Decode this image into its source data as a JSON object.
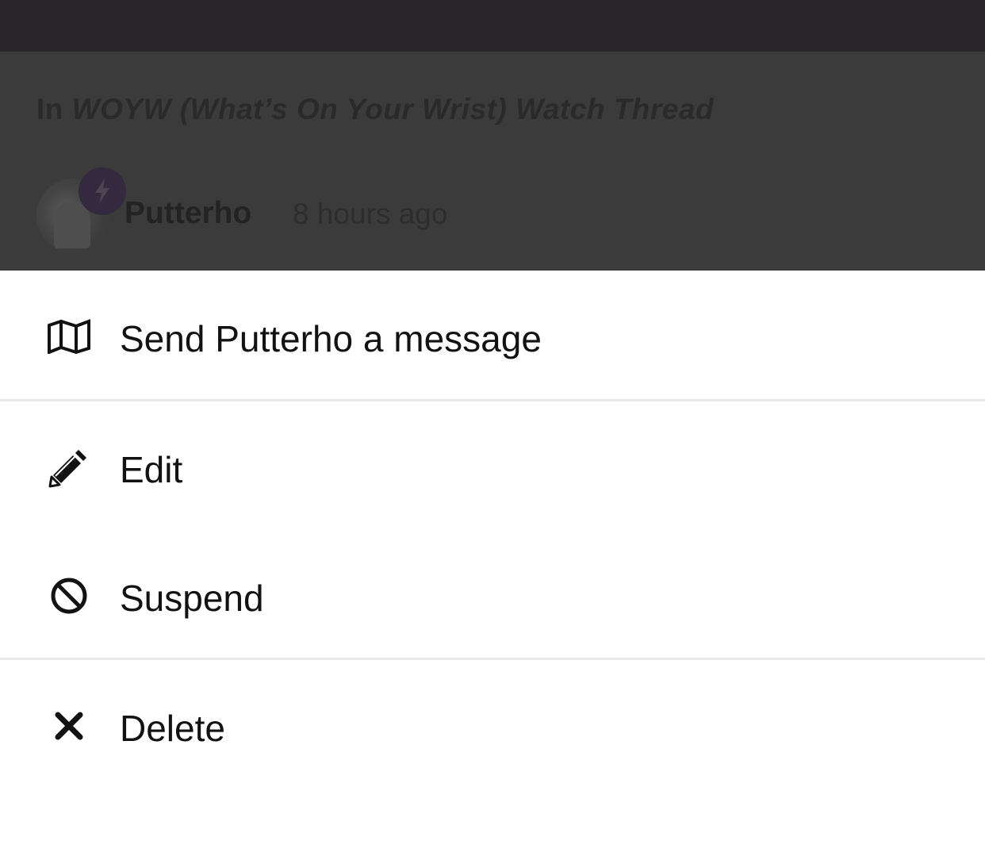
{
  "background_post": {
    "thread_prefix": "In",
    "thread_title": "WOYW (What’s On Your Wrist) Watch Thread",
    "author": "Putterho",
    "timestamp": "8 hours ago",
    "badge_icon": "lightning-icon",
    "avatar_icon": "user-avatar"
  },
  "action_sheet": {
    "items": [
      {
        "label": "Send Putterho a message",
        "icon": "map-icon"
      },
      {
        "label": "Edit",
        "icon": "pencil-icon"
      },
      {
        "label": "Suspend",
        "icon": "ban-icon"
      },
      {
        "label": "Delete",
        "icon": "close-icon"
      }
    ]
  },
  "colors": {
    "status_bar": "#282628",
    "overlay": "#3b3b3b",
    "sheet_background": "#ffffff",
    "text": "#121212",
    "divider": "#e9e9e9",
    "badge": "#35293f"
  }
}
